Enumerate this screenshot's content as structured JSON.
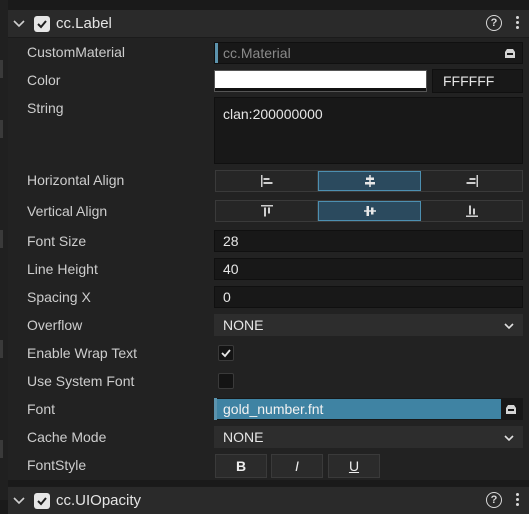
{
  "component": {
    "name": "cc.Label",
    "help": "?"
  },
  "properties": {
    "custom_material": {
      "label": "CustomMaterial",
      "value": "cc.Material"
    },
    "color": {
      "label": "Color",
      "swatch": "#FFFFFF",
      "hex": "FFFFFF"
    },
    "string": {
      "label": "String",
      "value": "clan:200000000"
    },
    "horizontal_align": {
      "label": "Horizontal Align",
      "options": [
        "left-align-icon",
        "center-align-icon",
        "right-align-icon"
      ],
      "selected": 1
    },
    "vertical_align": {
      "label": "Vertical Align",
      "options": [
        "top-align-icon",
        "middle-align-icon",
        "bottom-align-icon"
      ],
      "selected": 1
    },
    "font_size": {
      "label": "Font Size",
      "value": "28"
    },
    "line_height": {
      "label": "Line Height",
      "value": "40"
    },
    "spacing_x": {
      "label": "Spacing X",
      "value": "0"
    },
    "overflow": {
      "label": "Overflow",
      "value": "NONE"
    },
    "enable_wrap_text": {
      "label": "Enable Wrap Text",
      "checked": true
    },
    "use_system_font": {
      "label": "Use System Font",
      "checked": false
    },
    "font": {
      "label": "Font",
      "value": "gold_number.fnt"
    },
    "cache_mode": {
      "label": "Cache Mode",
      "value": "NONE"
    },
    "font_style": {
      "label": "FontStyle",
      "bold": "B",
      "italic": "I",
      "underline": "U"
    }
  },
  "next_component": {
    "name": "cc.UIOpacity"
  },
  "colors": {
    "accent": "#3F83A3",
    "selected_segment": "#2B4A5E",
    "panel": "#222222",
    "field": "#181818"
  }
}
